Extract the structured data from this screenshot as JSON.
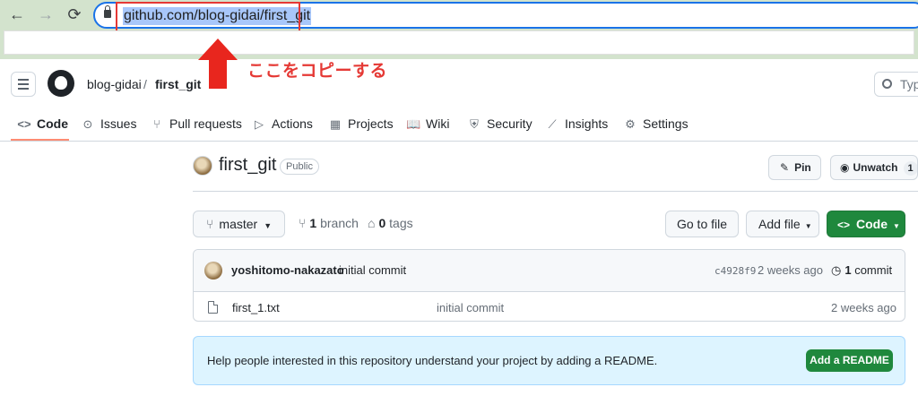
{
  "browser": {
    "back_icon": "←",
    "forward_icon": "→",
    "reload_icon": "⟳",
    "url": "github.com/blog-gidai/first_git"
  },
  "annotation": {
    "text": "ここをコピーする",
    "color": "#e53935"
  },
  "header": {
    "owner": "blog-gidai",
    "separator": "/",
    "repo": "first_git",
    "search_placeholder": "Type"
  },
  "tabs": [
    {
      "label": "Code",
      "icon": "<>"
    },
    {
      "label": "Issues",
      "icon": "⊙"
    },
    {
      "label": "Pull requests",
      "icon": "⑂"
    },
    {
      "label": "Actions",
      "icon": "▷"
    },
    {
      "label": "Projects",
      "icon": "▦"
    },
    {
      "label": "Wiki",
      "icon": "📖"
    },
    {
      "label": "Security",
      "icon": "⛨"
    },
    {
      "label": "Insights",
      "icon": "⟋"
    },
    {
      "label": "Settings",
      "icon": "⚙"
    }
  ],
  "repo": {
    "name": "first_git",
    "visibility": "Public",
    "pin_label": "Pin",
    "watch_label": "Unwatch",
    "watch_count": "1"
  },
  "branchbar": {
    "branch": "master",
    "branch_count": "1",
    "branch_word": "branch",
    "tag_count": "0",
    "tag_word": "tags",
    "goto_label": "Go to file",
    "add_label": "Add file",
    "code_label": "Code"
  },
  "commit": {
    "author": "yoshitomo-nakazato",
    "message": "initial commit",
    "sha": "c4928f9",
    "time": "2 weeks ago",
    "count": "1",
    "count_word": "commit"
  },
  "files": [
    {
      "name": "first_1.txt",
      "message": "initial commit",
      "time": "2 weeks ago"
    }
  ],
  "readme": {
    "text": "Help people interested in this repository understand your project by adding a README.",
    "button": "Add a README"
  },
  "colors": {
    "chrome_bg": "#d3e3cd",
    "primary_green": "#1f883d",
    "tab_underline": "#fd8c73",
    "banner_bg": "#ddf4ff"
  }
}
